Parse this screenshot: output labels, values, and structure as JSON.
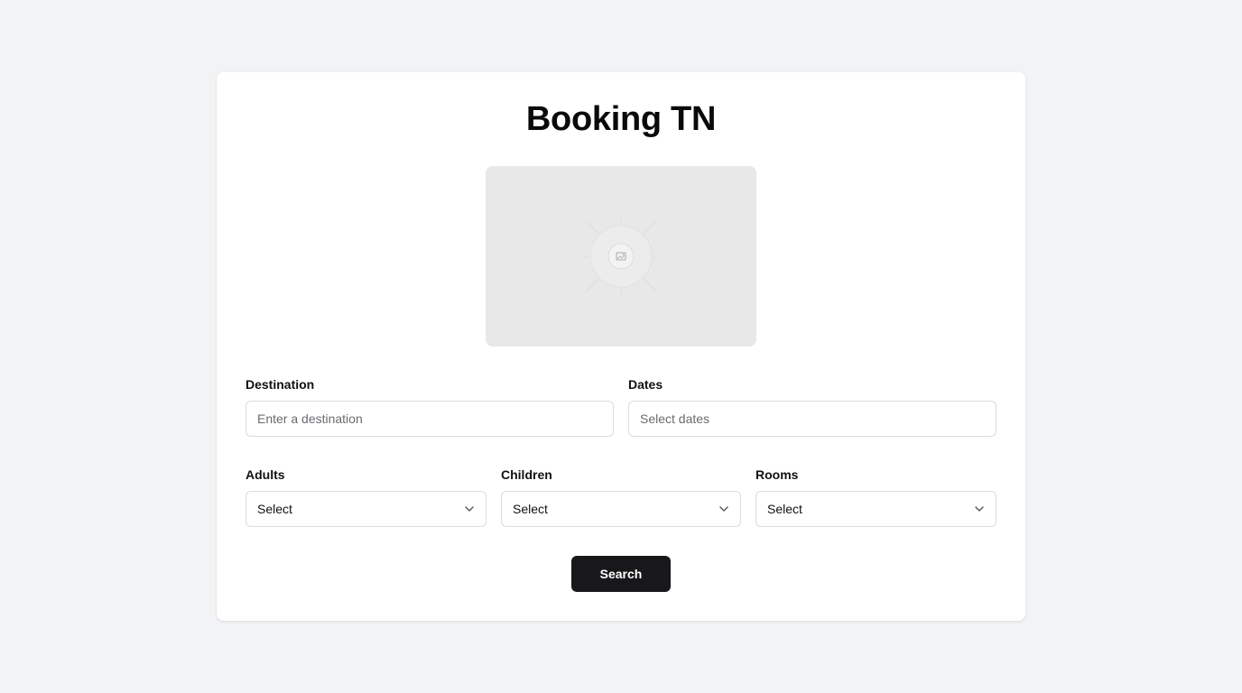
{
  "app": {
    "title": "Booking TN"
  },
  "hero_image": {
    "icon": "image-placeholder-icon"
  },
  "form": {
    "destination": {
      "label": "Destination",
      "placeholder": "Enter a destination",
      "value": ""
    },
    "dates": {
      "label": "Dates",
      "placeholder": "Select dates",
      "value": ""
    },
    "adults": {
      "label": "Adults",
      "selected": "Select"
    },
    "children": {
      "label": "Children",
      "selected": "Select"
    },
    "rooms": {
      "label": "Rooms",
      "selected": "Select"
    },
    "search_label": "Search"
  },
  "colors": {
    "page_background": "#f2f3f5",
    "card_background": "#ffffff",
    "button_background": "#18181b",
    "button_text": "#ffffff",
    "input_border": "#dcdcdf"
  }
}
